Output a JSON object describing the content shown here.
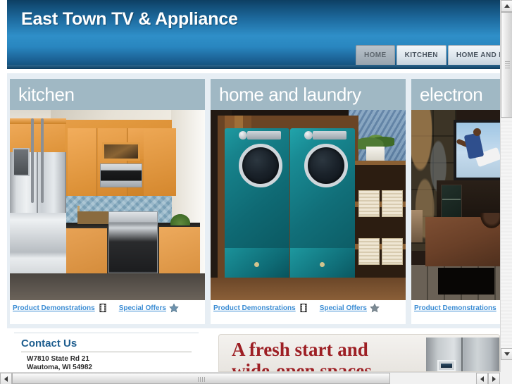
{
  "header": {
    "site_title": "East Town TV & Appliance",
    "nav": [
      {
        "label": "HOME",
        "active": true
      },
      {
        "label": "KITCHEN",
        "active": false
      },
      {
        "label": "HOME AND LA",
        "active": false
      }
    ]
  },
  "panels": [
    {
      "title": "kitchen",
      "photo_alt": "kitchen-photo",
      "links": [
        {
          "label": "Product Demonstrations",
          "icon": "filmstrip-icon"
        },
        {
          "label": "Special Offers",
          "icon": "star-icon"
        }
      ]
    },
    {
      "title": "home and laundry",
      "photo_alt": "laundry-photo",
      "links": [
        {
          "label": "Product Demonstrations",
          "icon": "filmstrip-icon"
        },
        {
          "label": "Special Offers",
          "icon": "star-icon"
        }
      ]
    },
    {
      "title": "electron",
      "photo_alt": "electronics-photo",
      "links": [
        {
          "label": "Product Demonstrations",
          "icon": "filmstrip-icon"
        }
      ]
    }
  ],
  "contact": {
    "title": "Contact Us",
    "address_line1": "W7810 State Rd 21",
    "address_line2": "Wautoma, WI 54982"
  },
  "promo": {
    "headline": "A fresh start and wide-open spaces",
    "image_alt": "refrigerator-photo"
  },
  "colors": {
    "header_blue_dark": "#0d3f63",
    "header_blue_light": "#2f8fc8",
    "panel_title_bg": "#a0b8c4",
    "link_blue": "#3c8dd4",
    "contact_title_blue": "#1d5d8e",
    "promo_red": "#9d1f24",
    "content_bg": "#e7eef4"
  },
  "scrollbars": {
    "vertical": {
      "name": "vertical-scrollbar"
    },
    "horizontal": {
      "name": "horizontal-scrollbar"
    }
  }
}
